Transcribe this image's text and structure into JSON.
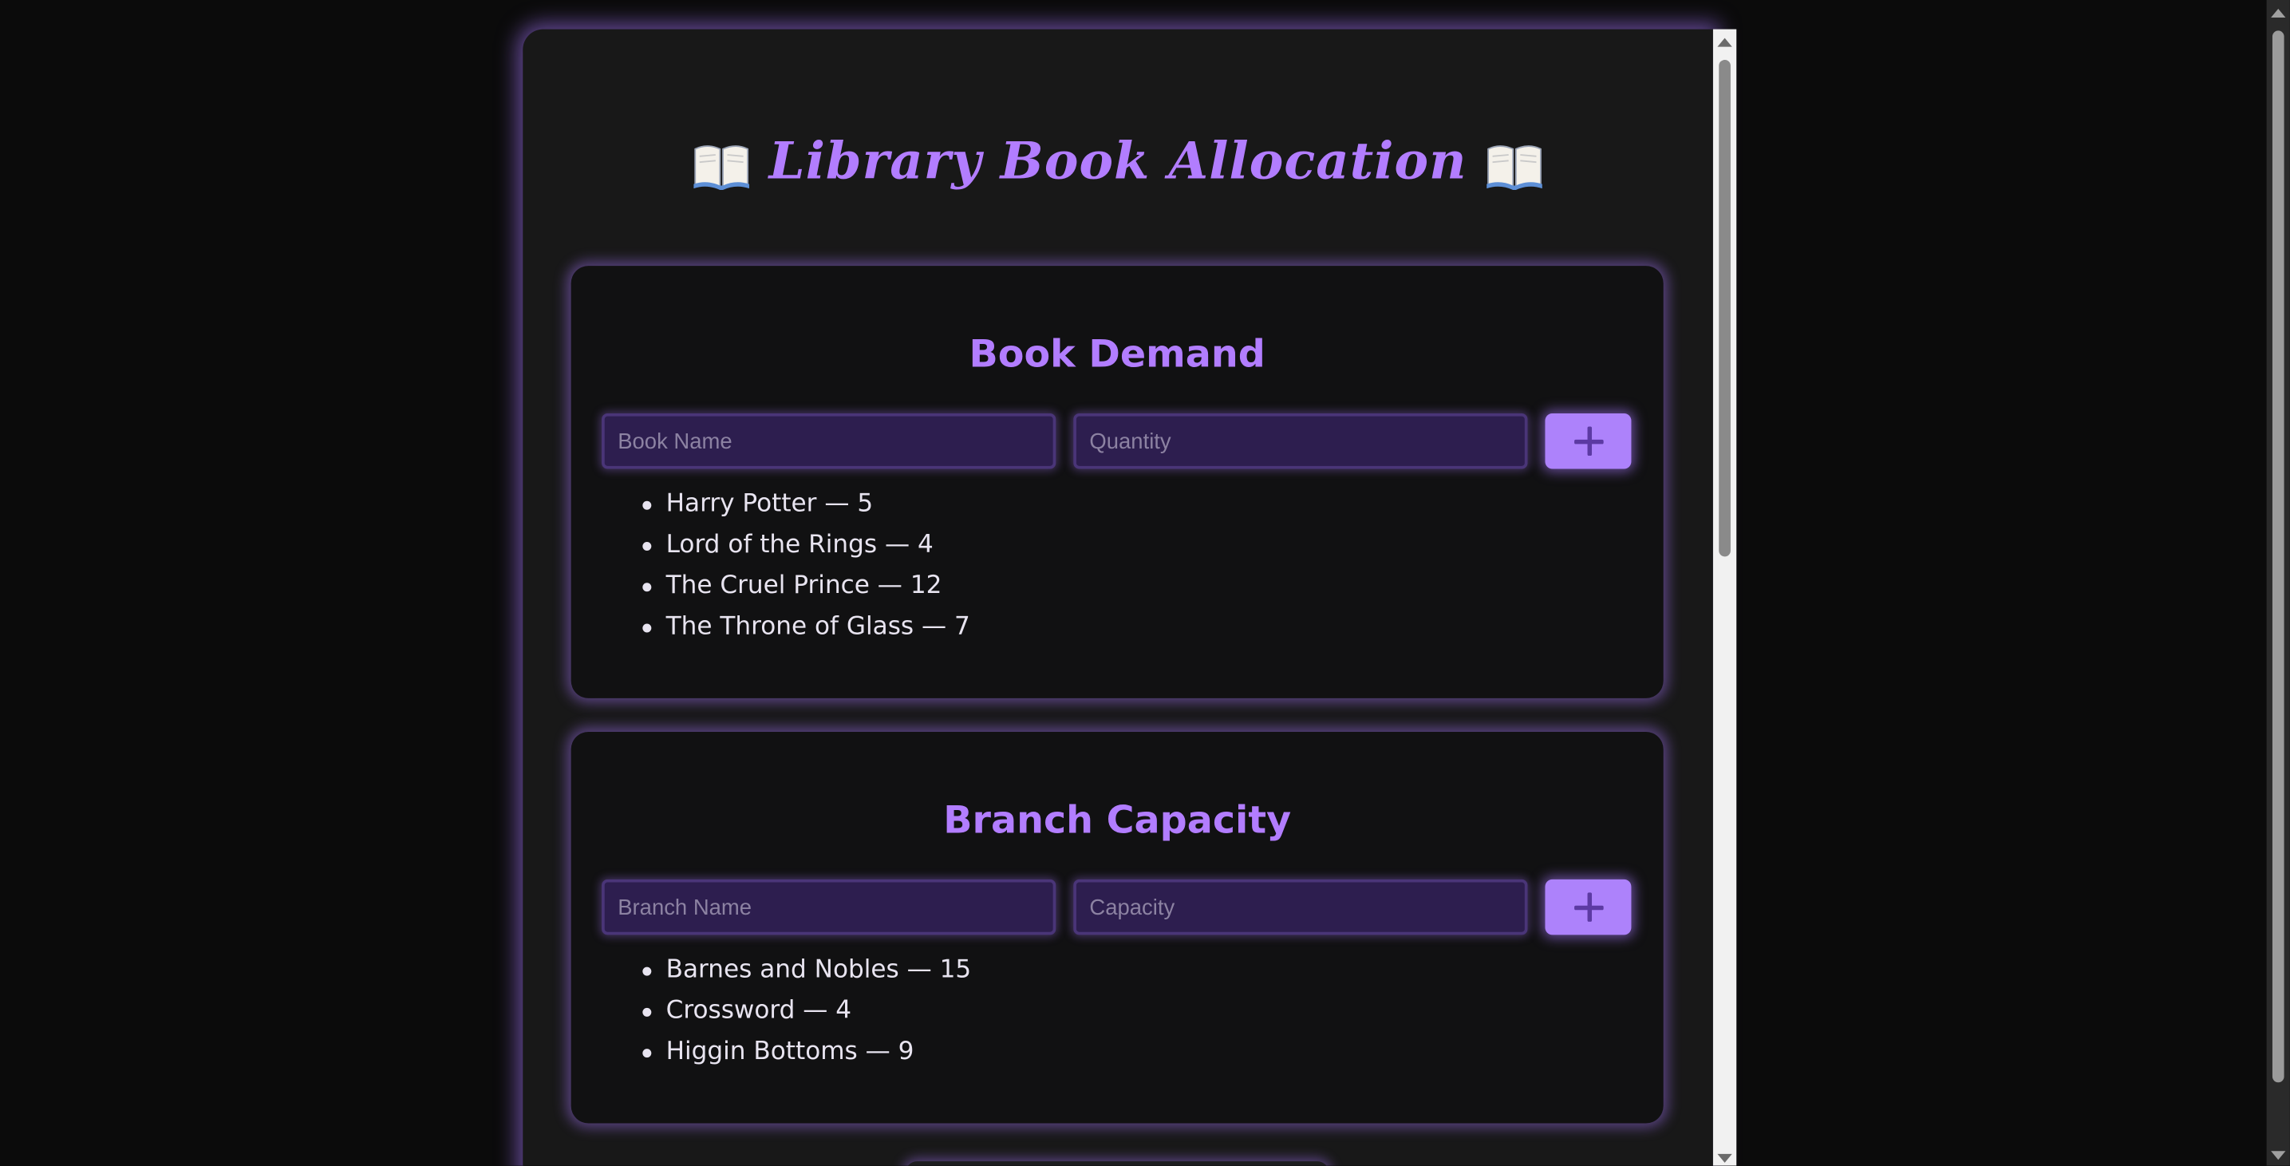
{
  "app": {
    "title": "Library Book Allocation",
    "title_icon": "open-book-icon",
    "accent_color": "#b27dff"
  },
  "book_demand": {
    "heading": "Book Demand",
    "name_placeholder": "Book Name",
    "quantity_placeholder": "Quantity",
    "add_button_icon": "plus-icon",
    "items": [
      "Harry Potter — 5",
      "Lord of the Rings — 4",
      "The Cruel Prince — 12",
      "The Throne of Glass — 7"
    ]
  },
  "branch_capacity": {
    "heading": "Branch Capacity",
    "name_placeholder": "Branch Name",
    "capacity_placeholder": "Capacity",
    "add_button_icon": "plus-icon",
    "items": [
      "Barnes and Nobles — 15",
      "Crossword — 4",
      "Higgin Bottoms — 9"
    ]
  }
}
